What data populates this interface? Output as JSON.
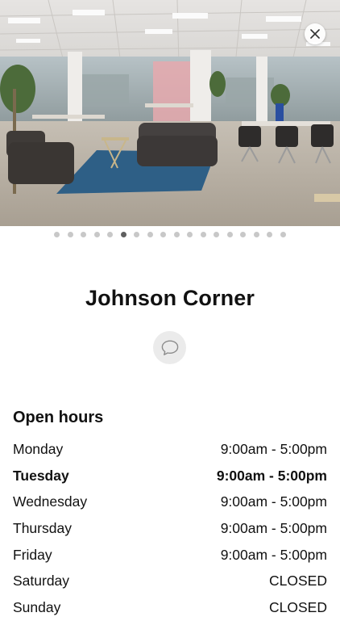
{
  "photo": {
    "image": "coworking-space-lounge-photo",
    "slide_count": 18,
    "active_slide_index": 5
  },
  "close_icon": "close-icon",
  "location": {
    "name": "Johnson Corner"
  },
  "chat_icon": "chat-bubble-icon",
  "open_hours": {
    "heading": "Open hours",
    "days": [
      {
        "day": "Monday",
        "hours": "9:00am - 5:00pm",
        "today": false
      },
      {
        "day": "Tuesday",
        "hours": "9:00am - 5:00pm",
        "today": true
      },
      {
        "day": "Wednesday",
        "hours": "9:00am - 5:00pm",
        "today": false
      },
      {
        "day": "Thursday",
        "hours": "9:00am - 5:00pm",
        "today": false
      },
      {
        "day": "Friday",
        "hours": "9:00am - 5:00pm",
        "today": false
      },
      {
        "day": "Saturday",
        "hours": "CLOSED",
        "today": false
      },
      {
        "day": "Sunday",
        "hours": "CLOSED",
        "today": false
      }
    ]
  },
  "colors": {
    "dot_inactive": "#c8c8c8",
    "dot_active": "#5f5f5f",
    "chat_button_bg": "#ebebeb",
    "rug": "#2e5f86"
  }
}
